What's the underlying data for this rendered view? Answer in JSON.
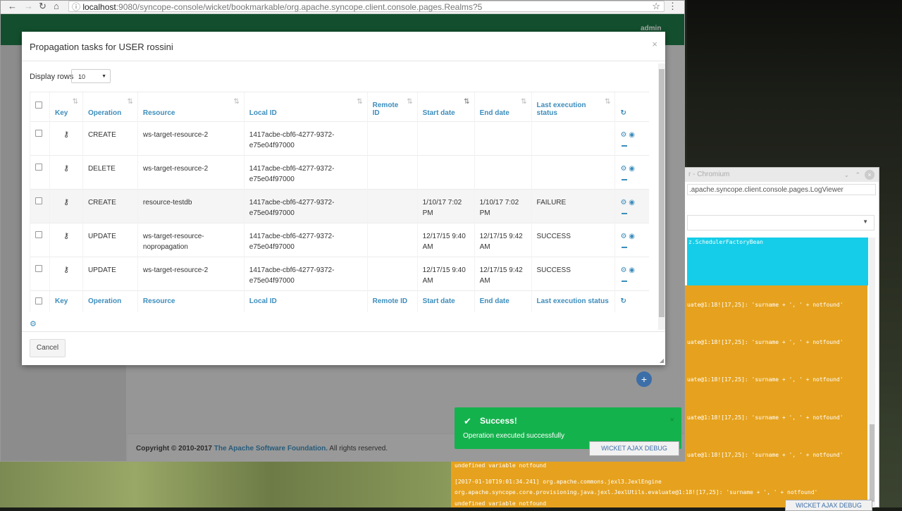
{
  "browser": {
    "url_host": "localhost",
    "url_path": ":9080/syncope-console/wicket/bookmarkable/org.apache.syncope.client.console.pages.Realms?5",
    "header_user": "admin"
  },
  "modal": {
    "title": "Propagation tasks for USER rossini",
    "display_rows_label": "Display rows",
    "display_rows_value": "10",
    "cancel_label": "Cancel",
    "columns": [
      "Key",
      "Operation",
      "Resource",
      "Local ID",
      "Remote ID",
      "Start date",
      "End date",
      "Last execution status"
    ],
    "rows": [
      {
        "operation": "CREATE",
        "resource": "ws-target-resource-2",
        "local_id": "1417acbe-cbf6-4277-9372-e75e04f97000",
        "remote_id": "",
        "start": "",
        "end": "",
        "status": ""
      },
      {
        "operation": "DELETE",
        "resource": "ws-target-resource-2",
        "local_id": "1417acbe-cbf6-4277-9372-e75e04f97000",
        "remote_id": "",
        "start": "",
        "end": "",
        "status": ""
      },
      {
        "operation": "CREATE",
        "resource": "resource-testdb",
        "local_id": "1417acbe-cbf6-4277-9372-e75e04f97000",
        "remote_id": "",
        "start": "1/10/17 7:02 PM",
        "end": "1/10/17 7:02 PM",
        "status": "FAILURE"
      },
      {
        "operation": "UPDATE",
        "resource": "ws-target-resource-nopropagation",
        "local_id": "1417acbe-cbf6-4277-9372-e75e04f97000",
        "remote_id": "",
        "start": "12/17/15 9:40 AM",
        "end": "12/17/15 9:42 AM",
        "status": "SUCCESS"
      },
      {
        "operation": "UPDATE",
        "resource": "ws-target-resource-2",
        "local_id": "1417acbe-cbf6-4277-9372-e75e04f97000",
        "remote_id": "",
        "start": "12/17/15 9:40 AM",
        "end": "12/17/15 9:42 AM",
        "status": "SUCCESS"
      }
    ]
  },
  "footer": {
    "copyright": "Copyright © 2010-2017",
    "org": "The Apache Software Foundation.",
    "rights": "All rights reserved."
  },
  "toast": {
    "title": "Success!",
    "message": "Operation executed successfully"
  },
  "debug_label": "WICKET AJAX DEBUG",
  "log_viewer": {
    "window_title": "r - Chromium",
    "url": ".apache.syncope.client.console.pages.LogViewer",
    "cyan_line": "z.SchedulerFactoryBean",
    "lines": [
      "uate@1:18![17,25]: 'surname + ', ' + notfound'",
      "uate@1:18![17,25]: 'surname + ', ' + notfound'",
      "uate@1:18![17,25]: 'surname + ', ' + notfound'",
      "uate@1:18![17,25]: 'surname + ', ' + notfound'",
      "uate@1:18![17,25]: 'surname + ', ' + notfound'",
      "undefined variable notfound",
      "[2017-01-10T19:01:34.241] org.apache.commons.jexl3.JexlEngine",
      "org.apache.syncope.core.provisioning.java.jexl.JexlUtils.evaluate@1:18![17,25]: 'surname + ', ' + notfound'",
      "undefined variable notfound"
    ]
  },
  "colors": {
    "header_green": "#1e7a47",
    "link_blue": "#3c8dbc",
    "toast_green": "#14b24d",
    "log_cyan": "#15cde8",
    "log_orange": "#e6a21e"
  }
}
